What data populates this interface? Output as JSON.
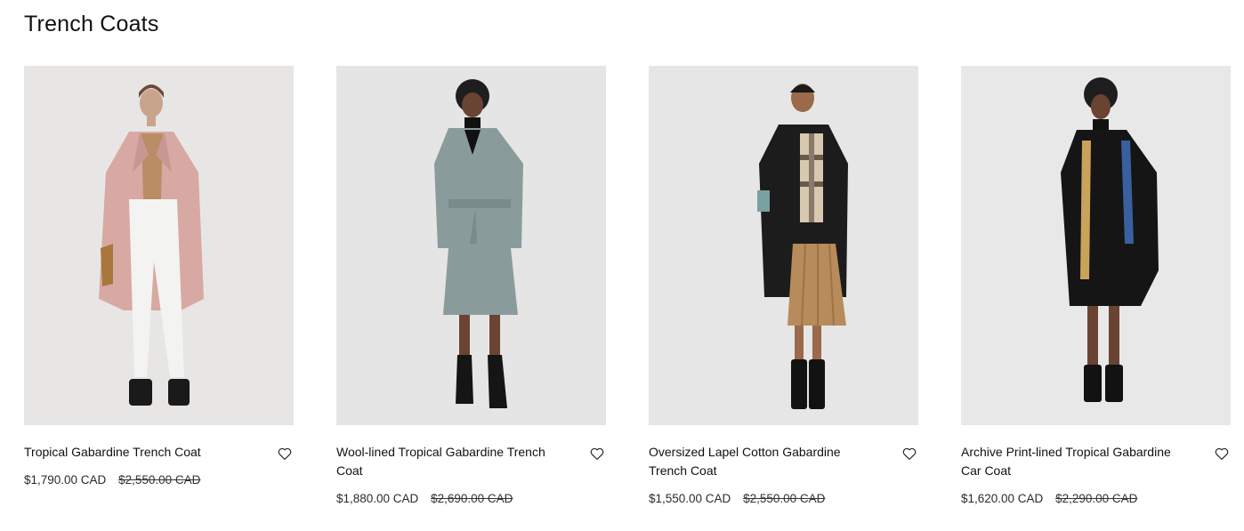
{
  "page": {
    "title": "Trench Coats"
  },
  "products": [
    {
      "name": "Tropical Gabardine Trench Coat",
      "price": "$1,790.00 CAD",
      "original_price": "$2,550.00 CAD",
      "image_alt": "Model wearing a pink trench coat",
      "coat_color": "#d8a9a2",
      "wishlist_icon": "heart-outline-icon"
    },
    {
      "name": "Wool-lined Tropical Gabardine Trench Coat",
      "price": "$1,880.00 CAD",
      "original_price": "$2,690.00 CAD",
      "image_alt": "Model wearing a grey-blue belted trench coat",
      "coat_color": "#8a9b9c",
      "wishlist_icon": "heart-outline-icon"
    },
    {
      "name": "Oversized Lapel Cotton Gabardine Trench Coat",
      "price": "$1,550.00 CAD",
      "original_price": "$2,550.00 CAD",
      "image_alt": "Model wearing a black trench coat with a pleated skirt",
      "coat_color": "#1c1c1c",
      "wishlist_icon": "heart-outline-icon"
    },
    {
      "name": "Archive Print-lined Tropical Gabardine Car Coat",
      "price": "$1,620.00 CAD",
      "original_price": "$2,290.00 CAD",
      "image_alt": "Model wearing a black car coat with printed lining",
      "coat_color": "#151515",
      "wishlist_icon": "heart-outline-icon"
    }
  ]
}
